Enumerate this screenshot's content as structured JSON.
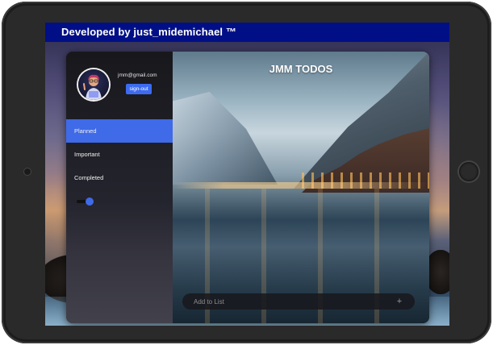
{
  "banner": {
    "text": "Developed by just_midemichael ™"
  },
  "sidebar": {
    "email": "jmm@gmail.com",
    "signout_label": "sign-out",
    "nav": [
      {
        "label": "Planned",
        "active": true
      },
      {
        "label": "Important",
        "active": false
      },
      {
        "label": "Completed",
        "active": false
      }
    ],
    "theme_toggle_on": true
  },
  "main": {
    "title": "JMM TODOS",
    "add_placeholder": "Add to List",
    "add_icon": "plus-icon"
  },
  "colors": {
    "banner": "#010f87",
    "accent": "#3f6ae8"
  }
}
